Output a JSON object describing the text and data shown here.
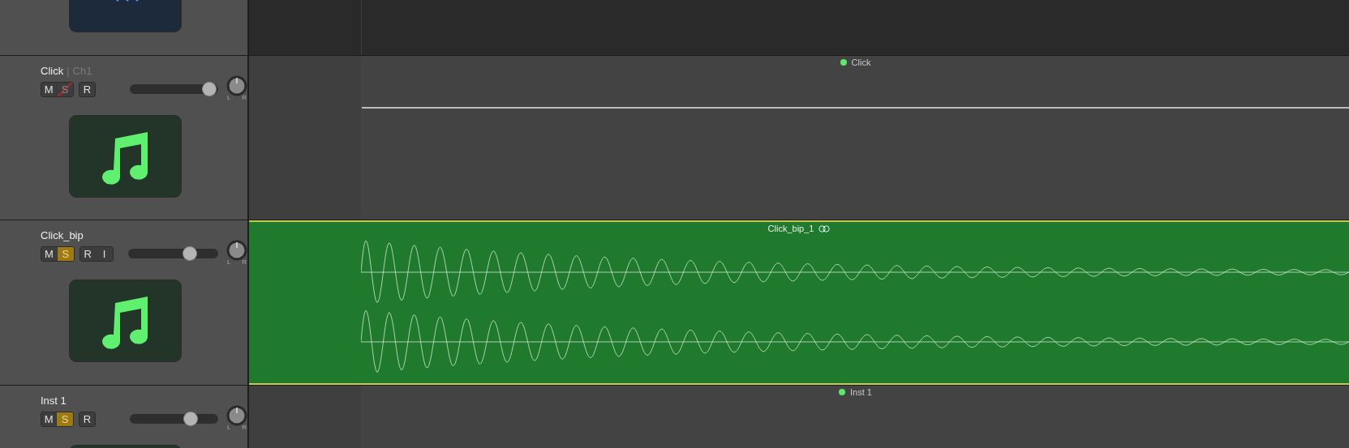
{
  "tracks": [
    {
      "kind": "stub",
      "icon": {
        "kind": "audio"
      },
      "lane": {
        "kind": "empty"
      }
    },
    {
      "kind": "full",
      "name": "Click",
      "separator": "|",
      "channel": "Ch1",
      "icon": {
        "kind": "instrument"
      },
      "button_groups": [
        [
          {
            "label": "M",
            "on": false,
            "disabled": false
          },
          {
            "label": "S",
            "on": false,
            "disabled": true
          }
        ],
        [
          {
            "label": "R",
            "on": false,
            "disabled": false
          }
        ]
      ],
      "level": 0.98,
      "pan_labels": [
        "L",
        "R"
      ],
      "lane": {
        "kind": "midi"
      },
      "region": {
        "name": "Click",
        "color": "#5ee86b"
      }
    },
    {
      "kind": "full",
      "name": "Click_bip",
      "icon": {
        "kind": "instrument"
      },
      "button_groups": [
        [
          {
            "label": "M",
            "on": false,
            "disabled": false
          },
          {
            "label": "S",
            "on": true,
            "disabled": false
          }
        ],
        [
          {
            "label": "R",
            "on": false,
            "disabled": false
          },
          {
            "label": "I",
            "on": false,
            "disabled": false
          }
        ]
      ],
      "level": 0.72,
      "pan_labels": [
        "L",
        "R"
      ],
      "lane": {
        "kind": "audio"
      },
      "region": {
        "name": "Click_bip_1",
        "looped": true
      }
    },
    {
      "kind": "full",
      "name": "Inst 1",
      "icon": {
        "kind": "instrument"
      },
      "button_groups": [
        [
          {
            "label": "M",
            "on": false,
            "disabled": false
          },
          {
            "label": "S",
            "on": true,
            "disabled": false
          }
        ],
        [
          {
            "label": "R",
            "on": false,
            "disabled": false
          }
        ]
      ],
      "level": 0.72,
      "pan_labels": [
        "L",
        "R"
      ],
      "lane": {
        "kind": "midi"
      },
      "region": {
        "name": "Inst 1",
        "color": "#5ee86b"
      }
    }
  ]
}
